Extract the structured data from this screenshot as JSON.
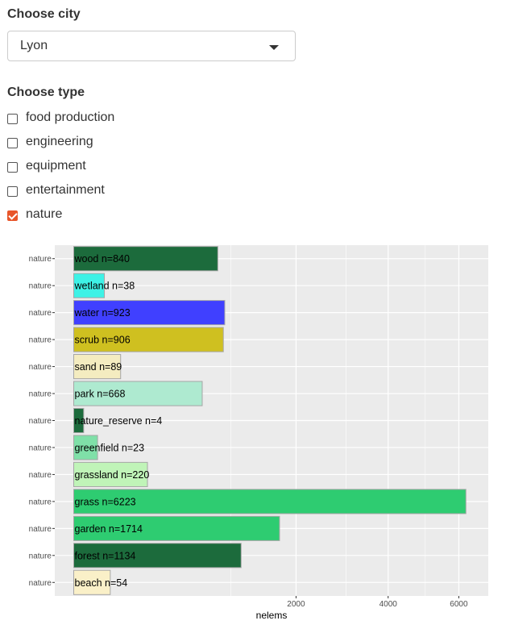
{
  "city_label": "Choose city",
  "city_select": {
    "value": "Lyon"
  },
  "type_label": "Choose type",
  "types": [
    {
      "label": "food production",
      "checked": false
    },
    {
      "label": "engineering",
      "checked": false
    },
    {
      "label": "equipment",
      "checked": false
    },
    {
      "label": "entertainment",
      "checked": false
    },
    {
      "label": "nature",
      "checked": true
    }
  ],
  "colors": {
    "checkbox_accent": "#e8562a",
    "panel_bg": "#ebebeb"
  },
  "chart_data": {
    "type": "bar",
    "orientation": "horizontal",
    "xlabel": "nelems",
    "x_scale": "sqrt",
    "xlim": [
      0,
      6500
    ],
    "x_ticks": [
      2000,
      4000,
      6000
    ],
    "grid": true,
    "categories": [
      "wood",
      "wetland",
      "water",
      "scrub",
      "sand",
      "park",
      "nature_reserve",
      "greenfield",
      "grassland",
      "grass",
      "garden",
      "forest",
      "beach"
    ],
    "y_labels": [
      "nature",
      "nature",
      "nature",
      "nature",
      "nature",
      "nature",
      "nature",
      "nature",
      "nature",
      "nature",
      "nature",
      "nature",
      "nature"
    ],
    "bar_labels": [
      "wood n=840",
      "wetland n=38",
      "water n=923",
      "scrub n=906",
      "sand n=89",
      "park n=668",
      "nature_reserve n=4",
      "greenfield n=23",
      "grassland n=220",
      "grass n=6223",
      "garden n=1714",
      "forest n=1134",
      "beach n=54"
    ],
    "values": [
      840,
      38,
      923,
      906,
      89,
      668,
      4,
      23,
      220,
      6223,
      1714,
      1134,
      54
    ],
    "bar_colors": [
      "#1c6b3c",
      "#3ef2e6",
      "#4040ff",
      "#cfc020",
      "#f4ecc0",
      "#aeead0",
      "#1c6b3c",
      "#7fe0a8",
      "#c0f4b8",
      "#2ecc71",
      "#2ecc71",
      "#1c6b3c",
      "#faf0c8"
    ]
  }
}
